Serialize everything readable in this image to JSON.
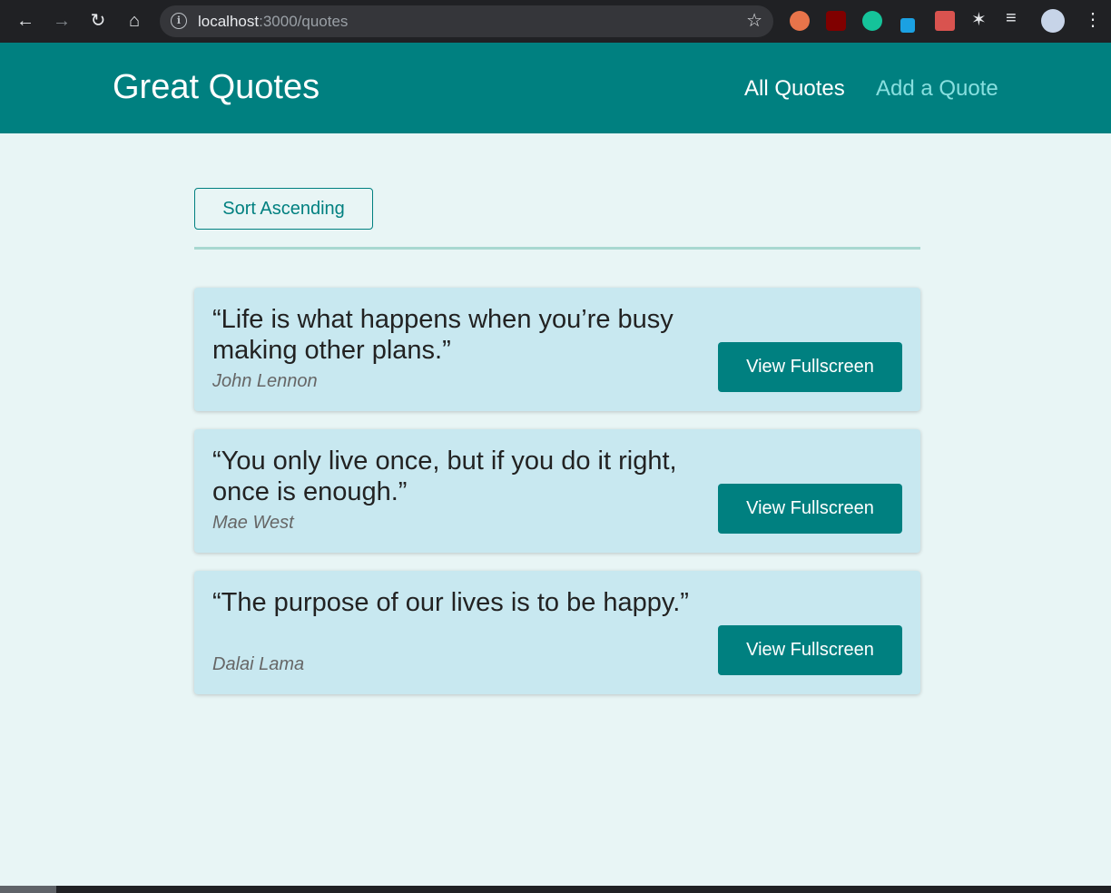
{
  "browser": {
    "url_host": "localhost",
    "url_path": ":3000/quotes"
  },
  "header": {
    "logo": "Great Quotes",
    "nav": [
      {
        "label": "All Quotes",
        "active": true
      },
      {
        "label": "Add a Quote",
        "active": false
      }
    ]
  },
  "toolbar": {
    "sort_label": "Sort Ascending"
  },
  "quotes": [
    {
      "text": "“Life is what happens when you’re busy making other plans.”",
      "author": "John Lennon",
      "button": "View Fullscreen"
    },
    {
      "text": "“You only live once, but if you do it right, once is enough.”",
      "author": "Mae West",
      "button": "View Fullscreen"
    },
    {
      "text": "“The purpose of our lives is to be happy.”",
      "author": "Dalai Lama",
      "button": "View Fullscreen"
    }
  ],
  "colors": {
    "brand": "#008080",
    "nav_inactive": "#88dfdf",
    "card_bg": "#c8e8f0",
    "page_bg": "#e8f5f5"
  },
  "icons": [
    "back-arrow-icon",
    "forward-arrow-icon",
    "reload-icon",
    "home-icon",
    "info-icon",
    "star-icon",
    "extensions-icon",
    "reading-list-icon",
    "profile-avatar",
    "menu-kebab-icon"
  ]
}
